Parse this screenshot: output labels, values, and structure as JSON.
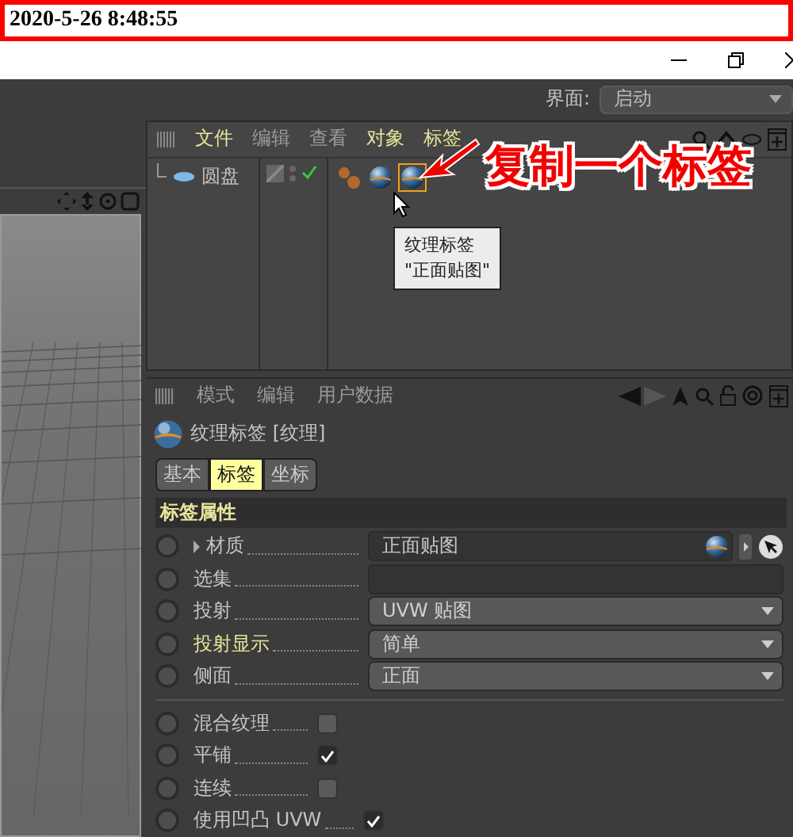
{
  "timestamp": "2020-5-26 8:48:55",
  "layout": {
    "label": "界面:",
    "value": "启动"
  },
  "object_manager": {
    "menu": [
      {
        "label": "文件",
        "highlighted": true
      },
      {
        "label": "编辑",
        "highlighted": false
      },
      {
        "label": "查看",
        "highlighted": false
      },
      {
        "label": "对象",
        "highlighted": true
      },
      {
        "label": "标签",
        "highlighted": true
      }
    ],
    "objects": [
      {
        "name": "圆盘",
        "tags": [
          {
            "kind": "phong",
            "selected": false
          },
          {
            "kind": "texture",
            "selected": false
          },
          {
            "kind": "texture",
            "selected": true
          }
        ]
      }
    ],
    "tooltip": [
      "纹理标签",
      "\"正面贴图\""
    ]
  },
  "annotation": "复制一个标签",
  "attribute_manager": {
    "menu": [
      "模式",
      "编辑",
      "用户数据"
    ],
    "title": "纹理标签 [纹理]",
    "tabs": [
      {
        "label": "基本",
        "selected": false
      },
      {
        "label": "标签",
        "selected": true
      },
      {
        "label": "坐标",
        "selected": false
      }
    ],
    "section": "标签属性",
    "properties": [
      {
        "kind": "link",
        "label": "材质",
        "value": "正面贴图",
        "highlighted": false,
        "expandable": true
      },
      {
        "kind": "field",
        "label": "选集",
        "highlighted": false
      },
      {
        "kind": "dropdown",
        "label": "投射",
        "value": "UVW 贴图",
        "highlighted": false
      },
      {
        "kind": "dropdown",
        "label": "投射显示",
        "value": "简单",
        "highlighted": true
      },
      {
        "kind": "dropdown",
        "label": "侧面",
        "value": "正面",
        "highlighted": false
      },
      {
        "kind": "divider"
      },
      {
        "kind": "checkbox",
        "label": "混合纹理",
        "checked": false,
        "highlighted": false
      },
      {
        "kind": "checkbox",
        "label": "平铺",
        "checked": true,
        "highlighted": false
      },
      {
        "kind": "checkbox",
        "label": "连续",
        "checked": false,
        "highlighted": false
      },
      {
        "kind": "checkbox",
        "label": "使用凹凸 UVW",
        "checked": true,
        "highlighted": false
      }
    ]
  }
}
